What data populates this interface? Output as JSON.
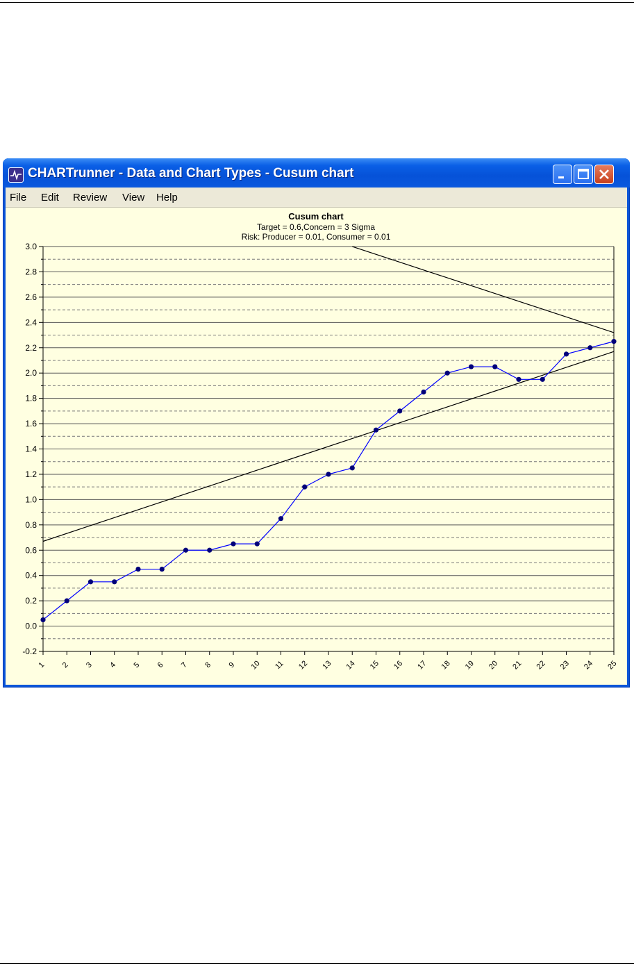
{
  "window": {
    "title": "CHARTrunner - Data and Chart Types - Cusum chart",
    "buttons": [
      "minimize",
      "maximize",
      "close"
    ]
  },
  "menu": {
    "items": [
      "File",
      "Edit",
      "Review",
      "View",
      "Help"
    ]
  },
  "chart_data": {
    "type": "line",
    "title": "Cusum chart",
    "subtitle_lines": [
      "Target = 0.6,Concern = 3 Sigma",
      "Risk: Producer = 0.01, Consumer = 0.01"
    ],
    "x": [
      1,
      2,
      3,
      4,
      5,
      6,
      7,
      8,
      9,
      10,
      11,
      12,
      13,
      14,
      15,
      16,
      17,
      18,
      19,
      20,
      21,
      22,
      23,
      24,
      25
    ],
    "x_tick_labels": [
      "1",
      "2",
      "3",
      "4",
      "5",
      "6",
      "7",
      "8",
      "9",
      "10",
      "11",
      "12",
      "13",
      "14",
      "15",
      "16",
      "17",
      "18",
      "19",
      "20",
      "21",
      "22",
      "23",
      "24",
      "25"
    ],
    "y_tick_labels": [
      "3.0",
      "2.8",
      "2.6",
      "2.4",
      "2.2",
      "2.0",
      "1.8",
      "1.6",
      "1.4",
      "1.2",
      "1.0",
      "0.8",
      "0.6",
      "0.4",
      "0.2",
      "0.0",
      "-0.2"
    ],
    "ylim": [
      -0.2,
      3.0
    ],
    "grid": "solid major lines at 0.2 steps, dashed minor lines at odd 0.1 steps",
    "series": [
      {
        "values": [
          0.05,
          0.2,
          0.35,
          0.35,
          0.45,
          0.45,
          0.6,
          0.6,
          0.65,
          0.65,
          0.85,
          1.1,
          1.2,
          1.25,
          1.55,
          1.7,
          1.85,
          2.0,
          2.05,
          2.05,
          1.95,
          1.95,
          2.15,
          2.2,
          2.25
        ],
        "color": "#0000ff",
        "marker_color": "#00007a"
      }
    ],
    "decision_lines": [
      {
        "x": [
          1,
          25
        ],
        "y": [
          0.67,
          2.17
        ],
        "color": "#000000"
      },
      {
        "x": [
          14.0,
          25
        ],
        "y": [
          3.0,
          2.32
        ],
        "color": "#000000"
      }
    ]
  }
}
